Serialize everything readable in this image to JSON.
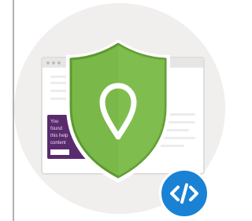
{
  "illustration": {
    "banner": {
      "line1": "You",
      "line2": "found",
      "line3": "this help",
      "line4": "content",
      "button_label": ""
    },
    "colors": {
      "shield_fill": "#7ab84a",
      "shield_border": "#5c9a2e",
      "banner": "#5a2a6e",
      "code_badge": "#1a82d4",
      "background_circle": "#f1eeee"
    },
    "icons": {
      "shield": "shield-icon",
      "location": "location-pin-icon",
      "code": "code-icon"
    }
  }
}
